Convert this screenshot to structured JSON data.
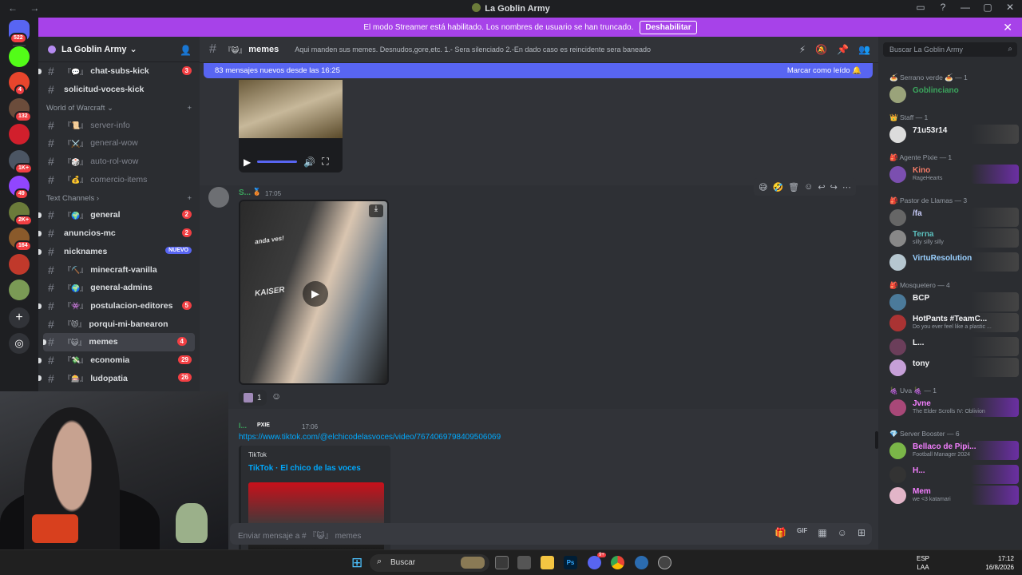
{
  "window": {
    "title": "La Goblin Army",
    "nav": "← →",
    "controls": [
      "▭",
      "?",
      "—",
      "▢",
      "✕"
    ]
  },
  "banner": {
    "text": "El modo Streamer está habilitado. Los nombres de usuario se han truncado.",
    "button": "Deshabilitar",
    "close": "✕"
  },
  "servers": [
    {
      "badge": "522",
      "color": "#5865f2"
    },
    {
      "badge": "",
      "color": "#53fc18"
    },
    {
      "badge": "4",
      "color": "#e8452c"
    },
    {
      "badge": "132",
      "color": "#6b4c3b"
    },
    {
      "badge": "",
      "color": "#d11f2c"
    },
    {
      "badge": "1K+",
      "color": "#4b5563"
    },
    {
      "badge": "49",
      "color": "#9146ff"
    },
    {
      "badge": "2K+",
      "color": "#6b7b3a"
    },
    {
      "badge": "164",
      "color": "#8a5a2b"
    },
    {
      "badge": "",
      "color": "#c0392b"
    },
    {
      "badge": "",
      "color": "#7a9a55"
    }
  ],
  "server_actions": {
    "add": "+",
    "explore": "◎"
  },
  "guild": {
    "name": "La Goblin Army",
    "chevron": "⌄",
    "add_person": "👤"
  },
  "channels_top": [
    {
      "name": "chat-subs-kick",
      "emoji": "『💬』",
      "badge": "3",
      "muted": false
    },
    {
      "name": "solicitud-voces-kick",
      "emoji": "",
      "badge": "",
      "muted": false
    }
  ],
  "category_wow": {
    "name": "World of Warcraft",
    "chevron": "⌄",
    "add": "+"
  },
  "channels_wow": [
    {
      "name": "server-info",
      "emoji": "『📜』"
    },
    {
      "name": "general-wow",
      "emoji": "『⚔️』"
    },
    {
      "name": "auto-rol-wow",
      "emoji": "『🎲』"
    },
    {
      "name": "comercio-items",
      "emoji": "『💰』"
    }
  ],
  "category_text": {
    "name": "Text Channels",
    "chevron": "›",
    "add": "+"
  },
  "channels_text": [
    {
      "name": "general",
      "emoji": "『🌍』",
      "badge": "2",
      "selected": false
    },
    {
      "name": "anuncios-mc",
      "emoji": "",
      "badge": "2",
      "selected": false
    },
    {
      "name": "nicknames",
      "emoji": "",
      "badge": "NUEVO",
      "selected": false
    },
    {
      "name": "minecraft-vanilla",
      "emoji": "『⛏️』",
      "badge": "",
      "selected": false
    },
    {
      "name": "general-admins",
      "emoji": "『🌍』",
      "badge": "",
      "selected": false
    },
    {
      "name": "postulacion-editores",
      "emoji": "『👾』",
      "badge": "5",
      "selected": false
    },
    {
      "name": "porqui-mi-banearon",
      "emoji": "『😾』",
      "badge": "",
      "selected": false
    },
    {
      "name": "memes",
      "emoji": "『😺』",
      "badge": "4",
      "selected": true
    },
    {
      "name": "economia",
      "emoji": "『💸』",
      "badge": "29",
      "selected": false
    },
    {
      "name": "ludopatia",
      "emoji": "『🎰』",
      "badge": "26",
      "selected": false
    }
  ],
  "chat_header": {
    "hash": "#",
    "emoji": "『😺』",
    "channel": "memes",
    "topic": "Aqui manden sus memes. Desnudos,gore,etc. 1.- Sera silenciado 2.-En dado caso es reincidente sera baneado",
    "icons": [
      "⚡",
      "🔕",
      "📌",
      "👥"
    ]
  },
  "new_messages": {
    "text": "83 mensajes nuevos desde las 16:25",
    "action": "Marcar como leído",
    "action_icon": "🔔"
  },
  "video1": {
    "play": "▶",
    "volume": "🔊",
    "fullscreen": "⛶"
  },
  "message1": {
    "author": "S...",
    "badge": "🥉",
    "time": "17:05"
  },
  "video2": {
    "download": "⤓",
    "play": "▶",
    "brand_top": "anda ves!",
    "brand": "KAISER"
  },
  "reaction": {
    "count": "1",
    "add": "☺"
  },
  "message_tools": [
    "😅",
    "🤣",
    "🗑",
    "☺",
    "↩",
    "↪",
    "⋯"
  ],
  "message2": {
    "author": "I...",
    "tag": "PXIE",
    "time": "17:06",
    "link": "https://www.tiktok.com/@elchicodelasvoces/video/7674069798409506069",
    "embed_provider": "TikTok",
    "embed_title": "TikTok · El chico de las voces"
  },
  "input": {
    "placeholder": "Enviar mensaje a # 『😺』 memes",
    "icons": [
      "🎁",
      "GIF",
      "▦",
      "☺",
      "⊞"
    ]
  },
  "members_search": {
    "placeholder": "Buscar La Goblin Army",
    "icon": "⌕"
  },
  "member_groups": [
    {
      "title": "🍝 Serrano verde 🍝 — 1",
      "members": [
        {
          "name": "Goblinciano",
          "status": "",
          "color": "#3ba55d",
          "av": "#9aa37a"
        }
      ]
    },
    {
      "title": "👑 Staff — 1",
      "members": [
        {
          "name": "71u53r14",
          "status": "",
          "color": "#f2f3f5",
          "av": "#dcdcdc"
        }
      ]
    },
    {
      "title": "🎒 Agente Pixie — 1",
      "members": [
        {
          "name": "Kino",
          "status": "RageHearts",
          "color": "#f47b67",
          "av": "#7b4fb0"
        }
      ]
    },
    {
      "title": "🎒 Pastor de Llamas — 3",
      "members": [
        {
          "name": "/fa",
          "status": "",
          "color": "#c9cdfb",
          "av": "#666"
        },
        {
          "name": "Terna",
          "status": "silly silly silly",
          "color": "#5bc0be",
          "av": "#888"
        },
        {
          "name": "VirtuResolution",
          "status": "",
          "color": "#9ad0ff",
          "av": "#b6c7d0"
        }
      ]
    },
    {
      "title": "🎒 Mosquetero — 4",
      "members": [
        {
          "name": "BCP",
          "status": "",
          "color": "#f2f3f5",
          "av": "#4b7a9a"
        },
        {
          "name": "HotPants #TeamC...",
          "status": "Do you ever feel like a plastic ...",
          "color": "#f2f3f5",
          "av": "#a33"
        },
        {
          "name": "L...",
          "status": "",
          "color": "#f2f3f5",
          "av": "#6b3e5a"
        },
        {
          "name": "tony",
          "status": "",
          "color": "#f2f3f5",
          "av": "#c6a0d8"
        }
      ]
    },
    {
      "title": "🍇 Uva 🍇 — 1",
      "members": [
        {
          "name": "Jvne",
          "status": "The Elder Scrolls IV: Oblivion",
          "color": "#f47fff",
          "av": "#a84878"
        }
      ]
    },
    {
      "title": "💎 Server Booster — 6",
      "members": [
        {
          "name": "Bellaco de Pipi...",
          "status": "Football Manager 2024",
          "color": "#f47fff",
          "av": "#7ab648"
        },
        {
          "name": "H...",
          "status": "",
          "color": "#f47fff",
          "av": "#333"
        },
        {
          "name": "Mem",
          "status": "we <3 katamari",
          "color": "#f47fff",
          "av": "#e2b5c8"
        }
      ]
    }
  ],
  "member_tags": {
    "kino": "RageHearts",
    "terna": "PXIE",
    "bcp": "NYUU",
    "hotpants": "Ahri",
    "bellaco": "DIOS",
    "mem": "778",
    "fa": "やしろ"
  },
  "taskbar": {
    "search": "Buscar",
    "lang": "ESP",
    "lang2": "LAA",
    "time": "17:12",
    "date": "16/8/2026",
    "start_icon": "⊞",
    "discord_badge": "9+"
  }
}
